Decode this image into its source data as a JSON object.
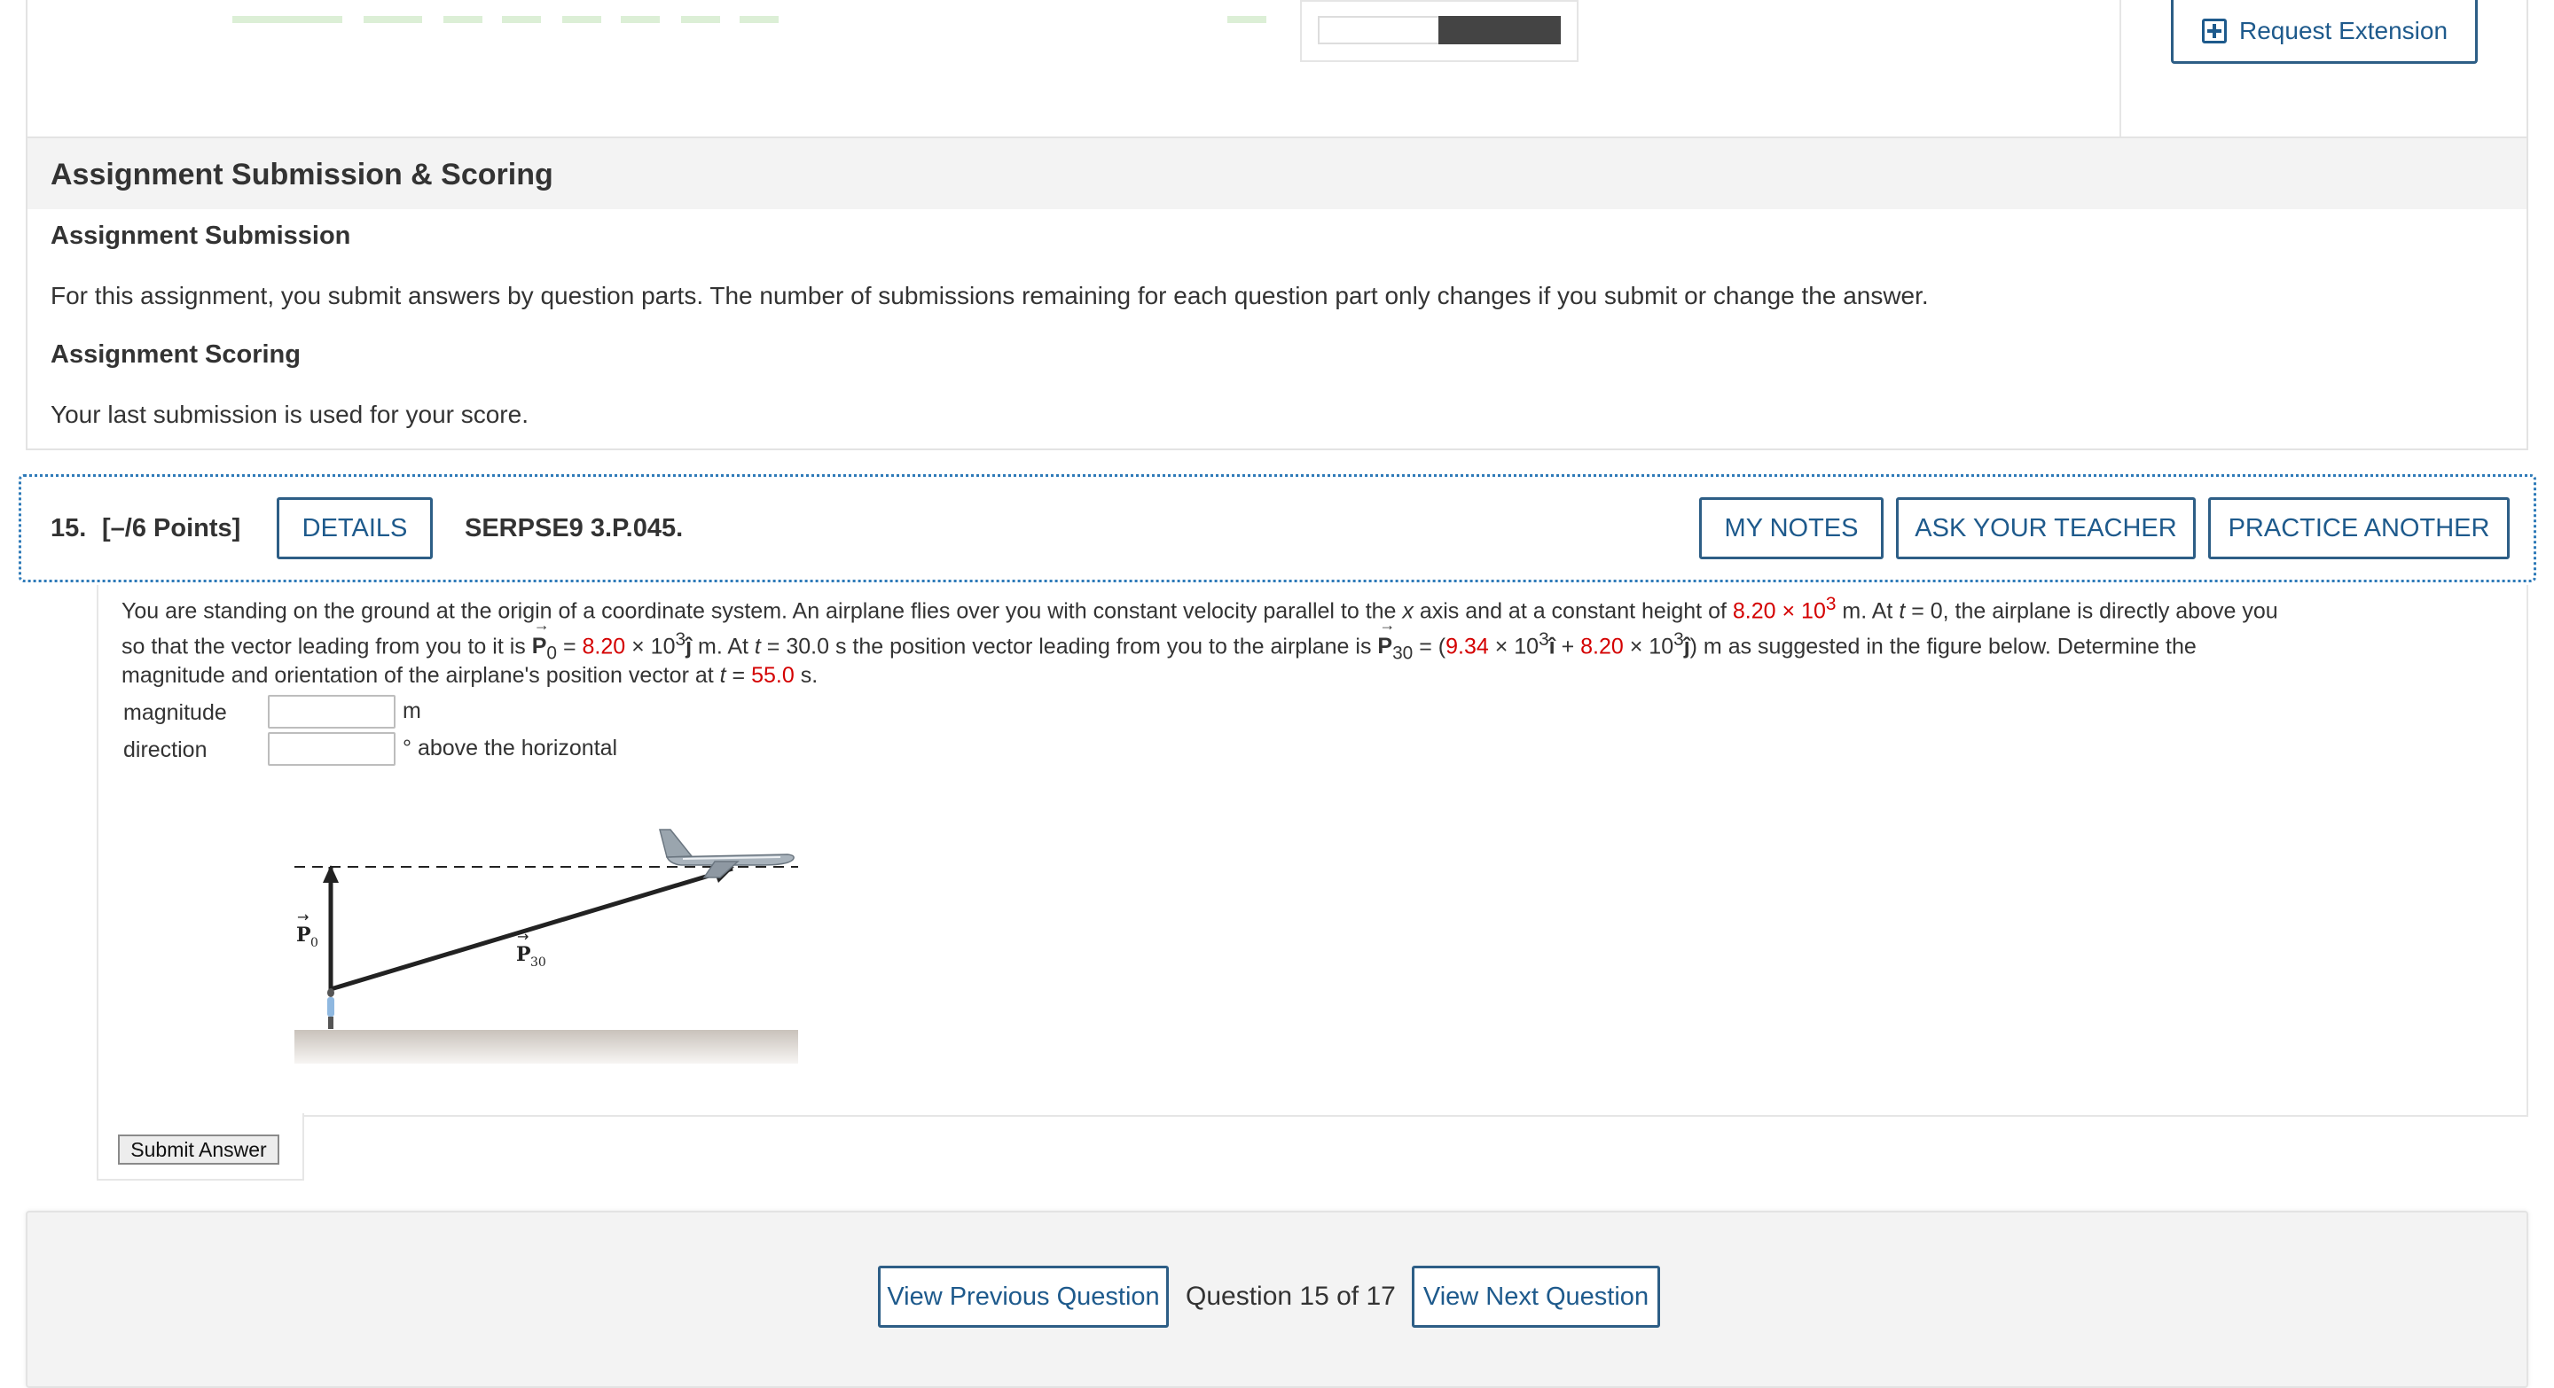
{
  "top": {
    "request_extension_label": "Request Extension"
  },
  "submission": {
    "section_title": "Assignment Submission & Scoring",
    "submission_heading": "Assignment Submission",
    "submission_text": "For this assignment, you submit answers by question parts. The number of submissions remaining for each question part only changes if you submit or change the answer.",
    "scoring_heading": "Assignment Scoring",
    "scoring_text": "Your last submission is used for your score."
  },
  "question": {
    "number": "15.",
    "points": "[–/6 Points]",
    "details_label": "DETAILS",
    "code": "SERPSE9 3.P.045.",
    "my_notes_label": "MY NOTES",
    "ask_teacher_label": "ASK YOUR TEACHER",
    "practice_label": "PRACTICE ANOTHER",
    "text": {
      "l1_a": "You are standing on the ground at the origin of a coordinate system. An airplane flies over you with constant velocity parallel to the ",
      "l1_x": "x",
      "l1_b": " axis and at a constant height of ",
      "height_mant": "8.20",
      "times": " × 10",
      "height_exp": "3",
      "l1_c": " m. At ",
      "t": "t",
      "l1_d": " = 0,  the airplane is directly above you",
      "l2_a": "so that the vector leading from you to it is ",
      "P": "P",
      "sub0": "0",
      "eq": " = ",
      "p0_mant": "8.20",
      "p0_exp": "3",
      "jhat": "ĵ",
      "l2_b": " m.  At ",
      "l2_c": " = 30.0 s  the position vector leading from you to the airplane is ",
      "sub30": "30",
      "l2_d": " = (",
      "p30_x": "9.34",
      "p30_xexp": "3",
      "ihat": "î",
      "plus": " + ",
      "p30_y": "8.20",
      "p30_yexp": "3",
      "l2_e": ") m  as suggested in the figure below. Determine the",
      "l3_a": "magnitude and orientation of the airplane's position vector at ",
      "l3_b": " = ",
      "t_final": "55.0",
      "l3_c": " s."
    },
    "magnitude_label": "magnitude",
    "magnitude_unit": "m",
    "direction_label": "direction",
    "direction_unit": "° above the horizontal",
    "magnitude_value": "",
    "direction_value": "",
    "figure": {
      "p0_label": "P",
      "p0_sub": "0",
      "p30_label": "P",
      "p30_sub": "30"
    },
    "submit_label": "Submit Answer"
  },
  "footer": {
    "prev_label": "View Previous Question",
    "position_text": "Question 15 of 17",
    "next_label": "View Next Question"
  },
  "colors": {
    "accent": "#1e5a8c",
    "given_values": "#d40000",
    "dotted_border": "#2e7ab8"
  }
}
